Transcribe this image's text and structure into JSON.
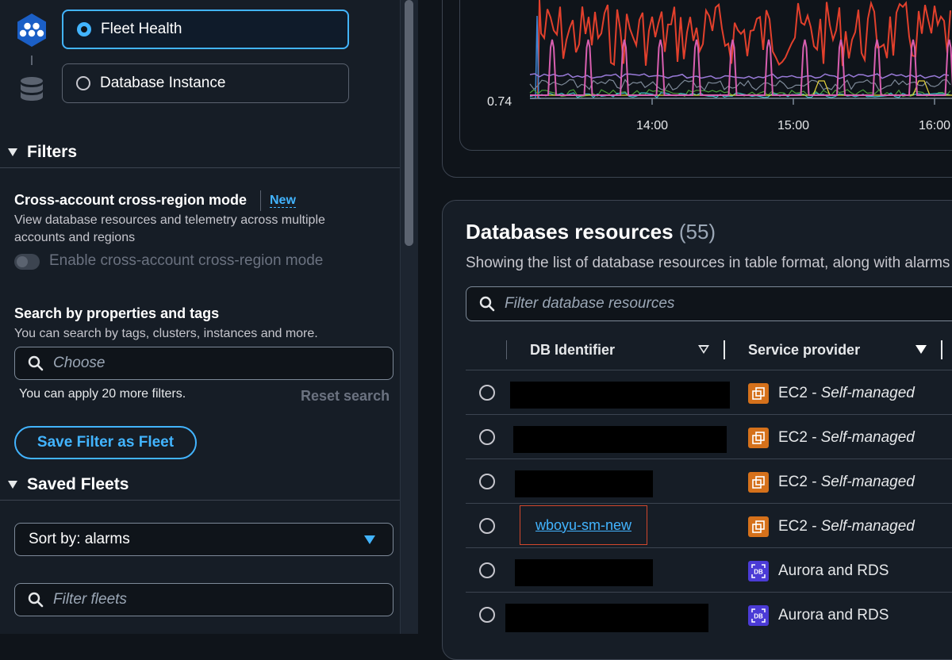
{
  "nav": {
    "options": [
      {
        "label": "Fleet Health",
        "selected": true
      },
      {
        "label": "Database Instance",
        "selected": false
      }
    ]
  },
  "filters": {
    "heading": "Filters",
    "cross_mode": {
      "title": "Cross-account cross-region mode",
      "badge": "New",
      "description_1": "View database resources and telemetry across multiple",
      "description_2": "accounts and regions",
      "toggle_label": "Enable cross-account cross-region mode",
      "enabled": false
    },
    "search": {
      "title": "Search by properties and tags",
      "description": "You can search by tags, clusters, instances and more.",
      "placeholder": "Choose",
      "note": "You can apply 20 more filters.",
      "reset_label": "Reset search"
    },
    "save_label": "Save Filter as Fleet"
  },
  "saved_fleets": {
    "heading": "Saved Fleets",
    "sort_value": "Sort by: alarms",
    "filter_placeholder": "Filter fleets"
  },
  "chart": {
    "y_tick": "0.74",
    "x_ticks": [
      "14:00",
      "15:00",
      "16:00"
    ],
    "colors": [
      "#e2402c",
      "#d85fb0",
      "#9a7bd9",
      "#7d8998",
      "#3fc1c9",
      "#e6d23c",
      "#4a9a3a",
      "#3d86d6"
    ]
  },
  "databases": {
    "title": "Databases resources",
    "count": "(55)",
    "subtitle": "Showing the list of database resources in table format, along with alarms",
    "search_placeholder": "Filter database resources",
    "columns": [
      "DB Identifier",
      "Service provider"
    ],
    "rows": [
      {
        "id": "",
        "redacted": true,
        "provider": "EC2 -",
        "provider_detail": "Self-managed",
        "icon": "ec2-icon"
      },
      {
        "id": "",
        "redacted": true,
        "provider": "EC2 -",
        "provider_detail": "Self-managed",
        "icon": "ec2-icon"
      },
      {
        "id": "",
        "redacted": true,
        "provider": "EC2 -",
        "provider_detail": "Self-managed",
        "icon": "ec2-icon"
      },
      {
        "id": "wboyu-sm-new",
        "redacted": false,
        "provider": "EC2 -",
        "provider_detail": "Self-managed",
        "icon": "ec2-icon"
      },
      {
        "id": "",
        "redacted": true,
        "provider": "Aurora and RDS",
        "provider_detail": "",
        "icon": "rds-icon"
      },
      {
        "id": "",
        "redacted": true,
        "provider": "Aurora and RDS",
        "provider_detail": "",
        "icon": "rds-icon"
      }
    ]
  }
}
